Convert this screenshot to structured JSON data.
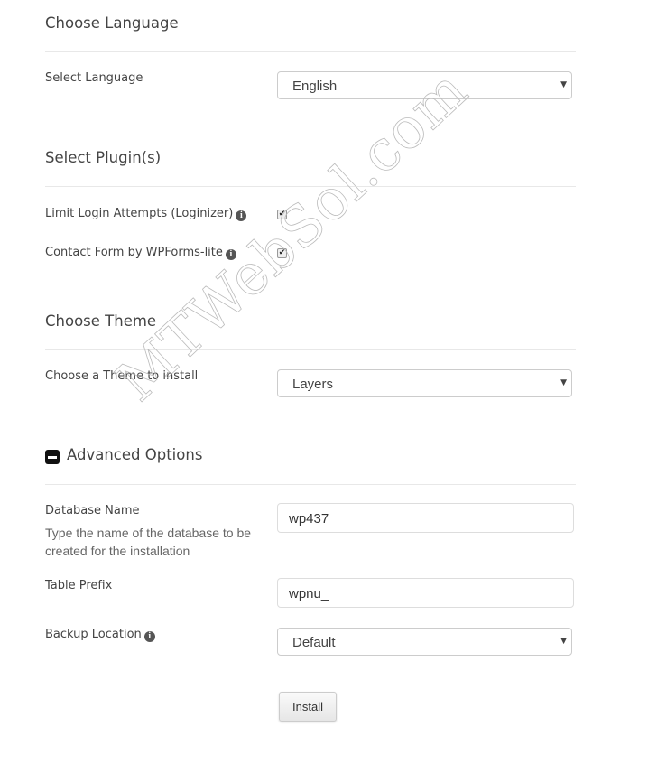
{
  "language_section": {
    "title": "Choose Language",
    "select_label": "Select Language",
    "selected": "English"
  },
  "plugins_section": {
    "title": "Select Plugin(s)",
    "plugins": [
      {
        "label": "Limit Login Attempts (Loginizer)",
        "checked": true,
        "check_glyph": "✔",
        "info_icon": "i"
      },
      {
        "label": "Contact Form by WPForms-lite",
        "checked": true,
        "check_glyph": "✔",
        "info_icon": "i"
      }
    ]
  },
  "theme_section": {
    "title": "Choose Theme",
    "select_label": "Choose a Theme to install",
    "selected": "Layers"
  },
  "advanced_section": {
    "title": "Advanced Options",
    "toggle_icon": "minus-square-icon",
    "database_name": {
      "label": "Database Name",
      "help": "Type the name of the database to be created for the installation",
      "value": "wp437"
    },
    "table_prefix": {
      "label": "Table Prefix",
      "value": "wpnu_"
    },
    "backup_location": {
      "label": "Backup Location",
      "info_icon": "i",
      "selected": "Default"
    }
  },
  "caret_glyph": "▼",
  "install_button": "Install",
  "watermark": "MTWebSol.com"
}
